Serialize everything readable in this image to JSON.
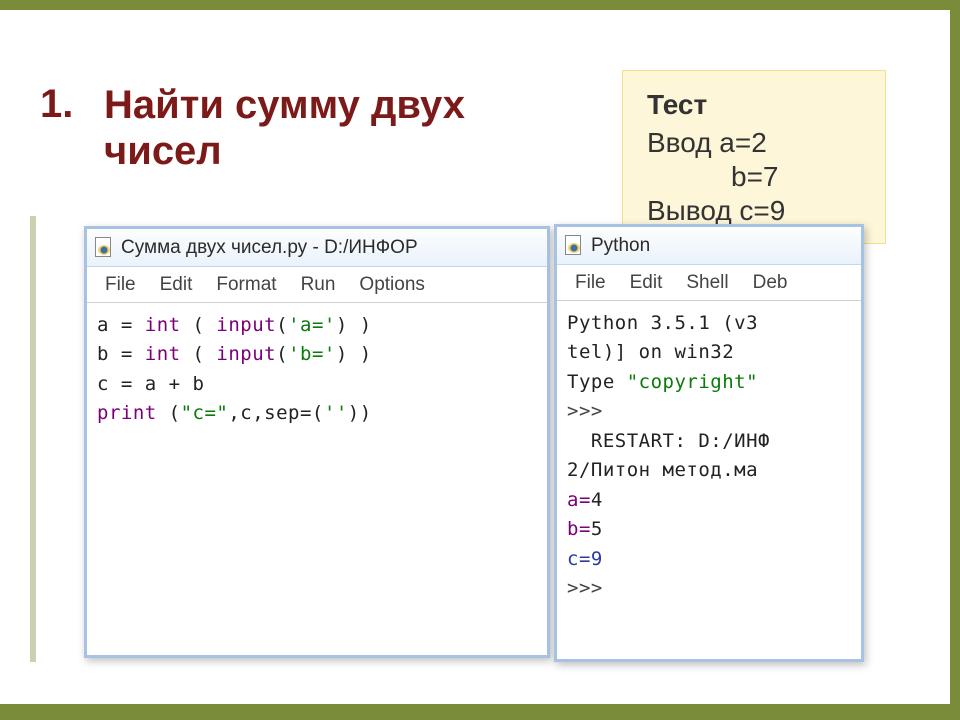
{
  "slide": {
    "number": "1.",
    "title_line1": "Найти сумму двух",
    "title_line2": "чисел"
  },
  "info": {
    "heading": "Тест",
    "rows": [
      "Ввод а=2",
      "b=7",
      "Вывод с=9"
    ]
  },
  "editor": {
    "title": "Сумма двух чисел.ру - D:/ИНФОР",
    "menu": [
      "File",
      "Edit",
      "Format",
      "Run",
      "Options"
    ],
    "code": {
      "l1": {
        "a": "a = ",
        "fn": "int",
        "p1": " ( ",
        "inp": "input",
        "p2": "(",
        "s": "'a='",
        "p3": ") )"
      },
      "l2": {
        "a": "b = ",
        "fn": "int",
        "p1": " ( ",
        "inp": "input",
        "p2": "(",
        "s": "'b='",
        "p3": ") )"
      },
      "l3": "c = a + b",
      "l4": {
        "fn": "print",
        "p1": " (",
        "s1": "\"c=\"",
        "mid": ",c,sep=(",
        "s2": "''",
        "p2": "))"
      }
    }
  },
  "shell": {
    "title": "Python",
    "menu": [
      "File",
      "Edit",
      "Shell",
      "Deb"
    ],
    "lines": {
      "l1a": "Python 3.5.1 (v3",
      "l1b": "tel)] on win32",
      "l2a": "Type ",
      "l2b": "\"copyright\"",
      "prompt": ">>>",
      "restart": "  RESTART: D:/ИНФ",
      "path2": "2/Питон метод.ма",
      "a": "a=",
      "av": "4",
      "b": "b=",
      "bv": "5",
      "c": "c=",
      "cv": "9"
    }
  }
}
